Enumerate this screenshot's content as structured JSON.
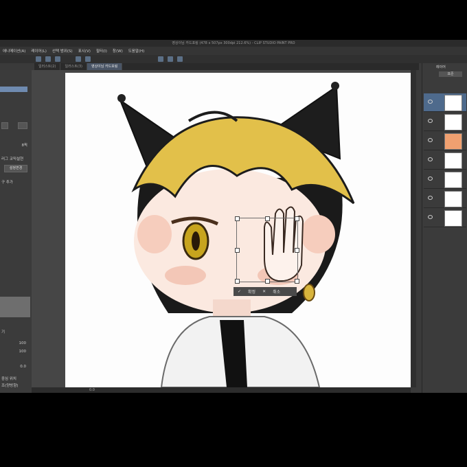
{
  "title": "영상이님 카드포링  (478 x 507px 300dpi 212.6%) - CLIP STUDIO PAINT PRO",
  "menu": [
    "애니메이션(A)",
    "레이어(L)",
    "선택 범위(S)",
    "표시(V)",
    "필터(I)",
    "창(W)",
    "도움말(H)"
  ],
  "tabs": [
    "일러스트(2)",
    "일러스트(3)",
    "영상이님 카드포링"
  ],
  "left_panel": {
    "value_1": "8픽",
    "label_1": "러그 코믹설현",
    "button_1": "설정변경",
    "label_2": "구 추가",
    "label_3": "기",
    "value_2": "100",
    "value_3": "100",
    "value_4": "0.0",
    "label_4": "중심 위치",
    "label_5": "조(양방향)"
  },
  "right_panel": {
    "header": "레이어",
    "blend_mode": "표준"
  },
  "transform": {
    "ok_label": "확정",
    "cancel_label": "취소"
  },
  "status": {
    "zoom": "0.0"
  }
}
